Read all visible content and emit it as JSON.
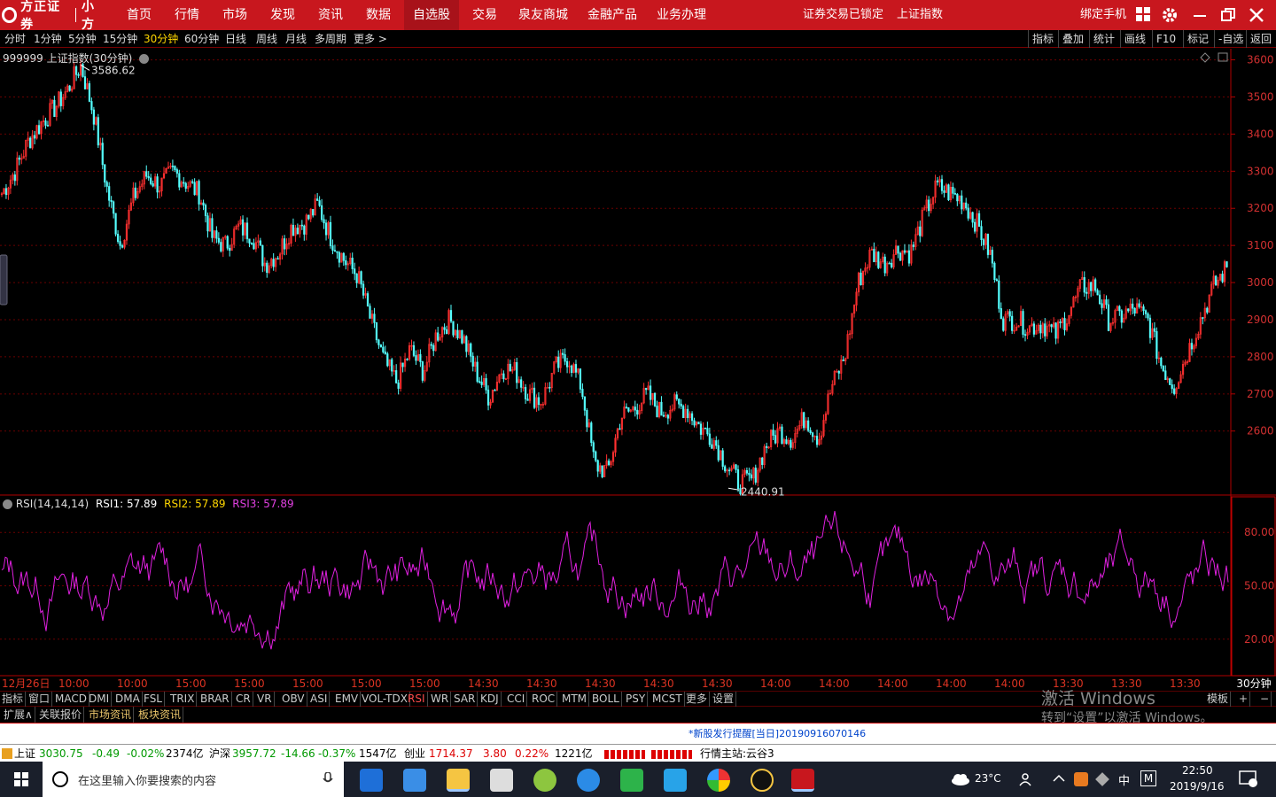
{
  "titlebar": {
    "logo_text": "方正证券",
    "logo_sub": "小方",
    "nav": [
      "首页",
      "行情",
      "市场",
      "发现",
      "资讯",
      "数据",
      "自选股",
      "交易",
      "泉友商城",
      "金融产品",
      "业务办理"
    ],
    "active_nav": "自选股",
    "lock_status": "证券交易已锁定",
    "index_name": "上证指数",
    "bind_phone": "绑定手机",
    "icons": [
      "grid-icon",
      "gear-icon",
      "minimize-icon",
      "restore-icon",
      "close-icon"
    ]
  },
  "periods": [
    "分时",
    "1分钟",
    "5分钟",
    "15分钟",
    "30分钟",
    "60分钟",
    "日线",
    "周线",
    "月线",
    "多周期",
    "更多 >"
  ],
  "active_period": "30分钟",
  "tools": [
    "指标",
    "叠加",
    "统计",
    "画线",
    "F10",
    "标记",
    "-自选",
    "返回"
  ],
  "chart_header": "999999 上证指数(30分钟)",
  "rsi_header": {
    "name": "RSI(14,14,14)",
    "rsi1": "RSI1: 57.89",
    "rsi2": "RSI2: 57.89",
    "rsi3": "RSI3: 57.89"
  },
  "chart_data": [
    {
      "type": "candlestick",
      "title": "999999 上证指数(30分钟)",
      "y_ticks": [
        3600,
        3500,
        3400,
        3300,
        3200,
        3100,
        3000,
        2900,
        2800,
        2700,
        2600
      ],
      "ylim": [
        2430,
        3630
      ],
      "annotations": [
        {
          "label": "3586.62",
          "kind": "max"
        },
        {
          "label": "2440.91",
          "kind": "min"
        }
      ],
      "closes": [
        3240,
        3300,
        3380,
        3430,
        3470,
        3520,
        3586,
        3450,
        3250,
        3100,
        3230,
        3290,
        3260,
        3300,
        3270,
        3240,
        3120,
        3100,
        3150,
        3130,
        3050,
        3080,
        3150,
        3160,
        3210,
        3120,
        3060,
        3020,
        2900,
        2790,
        2730,
        2820,
        2760,
        2860,
        2900,
        2850,
        2760,
        2690,
        2770,
        2760,
        2700,
        2680,
        2770,
        2800,
        2720,
        2510,
        2490,
        2640,
        2660,
        2700,
        2650,
        2670,
        2660,
        2610,
        2580,
        2510,
        2460,
        2470,
        2560,
        2600,
        2580,
        2640,
        2580,
        2720,
        2800,
        3000,
        3080,
        3050,
        3090,
        3080,
        3180,
        3260,
        3240,
        3220,
        3160,
        3080,
        2900,
        2900,
        2880,
        2890,
        2860,
        2920,
        2990,
        2990,
        2900,
        2910,
        2930,
        2900,
        2780,
        2720,
        2810,
        2900,
        2990,
        3040
      ]
    },
    {
      "type": "line",
      "title": "RSI(14,14,14)",
      "y_ticks": [
        80,
        50,
        20
      ],
      "ylim": [
        0,
        100
      ]
    }
  ],
  "x_labels": [
    "12月26日",
    "10:00",
    "10:00",
    "15:00",
    "15:00",
    "15:00",
    "15:00",
    "15:00",
    "14:30",
    "14:30",
    "14:30",
    "14:30",
    "14:30",
    "14:00",
    "14:00",
    "14:00",
    "14:00",
    "14:00",
    "13:30",
    "13:30",
    "13:30"
  ],
  "period_label": "30分钟",
  "indicator_tabs": [
    "指标",
    "窗口",
    "MACD",
    "DMI",
    "DMA",
    "FSL",
    "TRIX",
    "BRAR",
    "CR",
    "VR",
    "OBV",
    "ASI",
    "EMV",
    "VOL-TDX",
    "RSI",
    "WR",
    "SAR",
    "KDJ",
    "CCI",
    "ROC",
    "MTM",
    "BOLL",
    "PSY",
    "MCST",
    "更多",
    "设置"
  ],
  "active_indicator": "RSI",
  "template_tab": "模板",
  "ext_tabs": [
    "扩展∧",
    "关联报价",
    "市场资讯",
    "板块资讯"
  ],
  "watermark": [
    "激活 Windows",
    "转到“设置”以激活 Windows。"
  ],
  "news": "*新股发行提醒[当日]20190916070146",
  "ticker": {
    "sh_label": "上证",
    "sh_val": "3030.75",
    "sh_chg": "-0.49",
    "sh_pct": "-0.02%",
    "sh_amt": "2374亿",
    "hs_label": "沪深",
    "hs_val": "3957.72",
    "hs_chg": "-14.66",
    "hs_pct": "-0.37%",
    "hs_amt": "1547亿",
    "cy_label": "创业",
    "cy_val": "1714.37",
    "cy_chg": "3.80",
    "cy_pct": "0.22%",
    "cy_amt": "1221亿",
    "server": "行情主站:云谷3"
  },
  "taskbar": {
    "search_placeholder": "在这里输入你要搜索的内容",
    "weather": "23°C",
    "ime": "中",
    "time": "22:50",
    "date": "2019/9/16"
  }
}
